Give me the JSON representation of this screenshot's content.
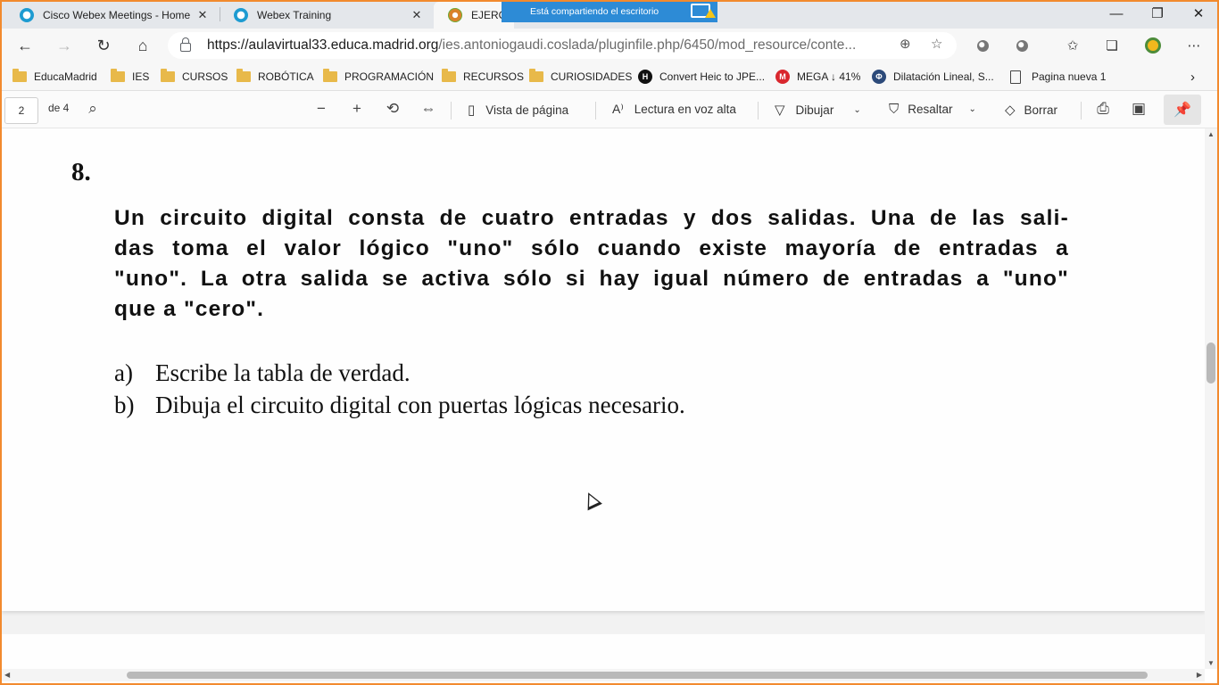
{
  "tabs": [
    {
      "title": "Cisco Webex Meetings - Home",
      "color": "#1d9bd1"
    },
    {
      "title": "Webex Training",
      "color": "#1d9bd1"
    },
    {
      "title": "EJERCIC",
      "color": "#d9822b"
    }
  ],
  "share_banner": "Está compartiendo el escritorio",
  "address": {
    "host": "https://aulavirtual33.educa.madrid.org",
    "path": "/ies.antoniogaudi.coslada/pluginfile.php/6450/mod_resource/conte..."
  },
  "bookmarks": [
    {
      "label": "EducaMadrid",
      "type": "folder"
    },
    {
      "label": "IES",
      "type": "folder"
    },
    {
      "label": "CURSOS",
      "type": "folder"
    },
    {
      "label": "ROBÓTICA",
      "type": "folder"
    },
    {
      "label": "PROGRAMACIÓN",
      "type": "folder"
    },
    {
      "label": "RECURSOS",
      "type": "folder"
    },
    {
      "label": "CURIOSIDADES",
      "type": "folder"
    },
    {
      "label": "Convert Heic to JPE...",
      "type": "site",
      "glyph": "H",
      "color": "#111111"
    },
    {
      "label": "MEGA ↓ 41%",
      "type": "site",
      "glyph": "M",
      "color": "#d9272e"
    },
    {
      "label": "Dilatación Lineal, S...",
      "type": "site",
      "glyph": "Φ",
      "color": "#2c4a7a"
    },
    {
      "label": "Pagina nueva 1",
      "type": "page"
    }
  ],
  "pdf_toolbar": {
    "page_current": "2",
    "page_total": "de 4",
    "page_view": "Vista de página",
    "read_aloud": "Lectura en voz alta",
    "draw": "Dibujar",
    "highlight": "Resaltar",
    "erase": "Borrar"
  },
  "document": {
    "question_number": "8.",
    "statement_lines": [
      "Un circuito digital consta de cuatro entradas y dos salidas. Una de las sali-",
      "das toma el valor lógico \"uno\" sólo cuando existe mayoría de entradas a",
      "\"uno\". La otra salida se activa sólo si hay igual número de entradas a \"uno\"",
      "que a \"cero\"."
    ],
    "items": [
      {
        "marker": "a)",
        "text": "Escribe la tabla de verdad."
      },
      {
        "marker": "b)",
        "text": "Dibuja el circuito digital con puertas lógicas necesario."
      }
    ]
  },
  "colors": {
    "accent_border": "#f28a2e",
    "share_banner": "#2d8bd6"
  }
}
